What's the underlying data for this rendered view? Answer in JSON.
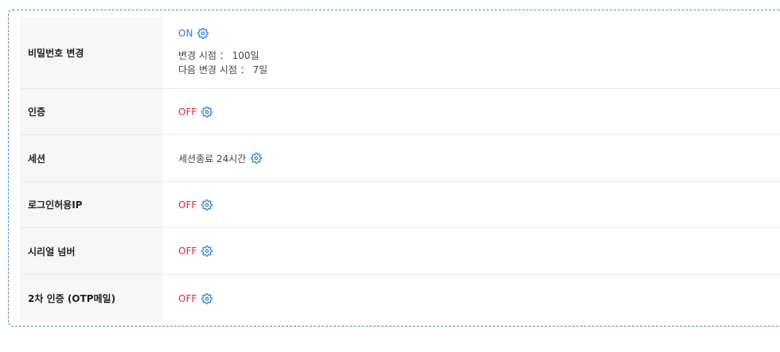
{
  "accent_color": "#2a7bd1",
  "off_color": "#d9264a",
  "rows": [
    {
      "label": "비밀번호 변경",
      "status": "ON",
      "info": [
        "변경 시점 ： 100일",
        "다음 변경 시점 ： 7일"
      ]
    },
    {
      "label": "인증",
      "status": "OFF"
    },
    {
      "label": "세션",
      "status": "세션종료 24시간"
    },
    {
      "label": "로그인허용IP",
      "status": "OFF"
    },
    {
      "label": "시리얼 넘버",
      "status": "OFF"
    },
    {
      "label": "2차 인증 (OTP메일)",
      "status": "OFF"
    }
  ],
  "icons": {
    "settings": "gear-icon"
  }
}
